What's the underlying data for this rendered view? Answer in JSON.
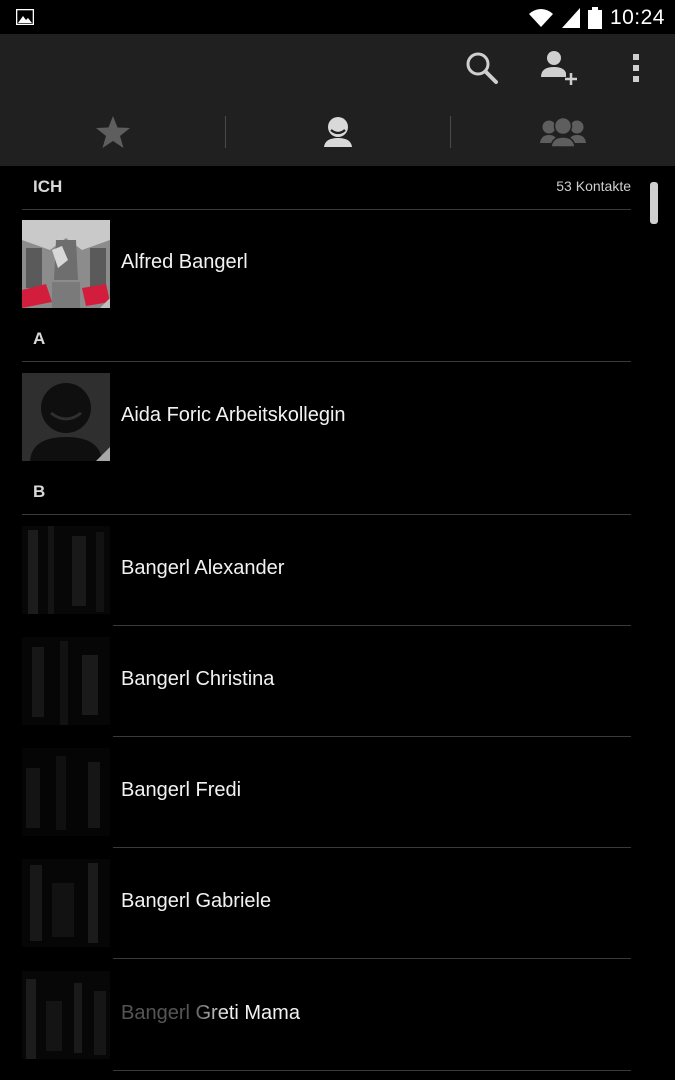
{
  "status_bar": {
    "time": "10:24",
    "left_icon": "gallery-notification-icon",
    "icons": [
      "wifi-icon",
      "signal-icon",
      "battery-icon"
    ]
  },
  "action_bar": {
    "actions": [
      {
        "icon": "search-icon",
        "label": "Search"
      },
      {
        "icon": "add-contact-icon",
        "label": "Add contact"
      },
      {
        "icon": "overflow-menu-icon",
        "label": "More options"
      }
    ]
  },
  "tabs": [
    {
      "icon": "star-icon",
      "selected": false
    },
    {
      "icon": "person-icon",
      "selected": true
    },
    {
      "icon": "group-icon",
      "selected": false
    }
  ],
  "list": {
    "me_header": {
      "label": "ICH",
      "count": "53 Kontakte"
    },
    "me": {
      "name": "Alfred Bangerl"
    },
    "sections": [
      {
        "letter": "A",
        "contacts": [
          {
            "name": "Aida Foric Arbeitskollegin",
            "avatar": "default-avatar"
          }
        ]
      },
      {
        "letter": "B",
        "contacts": [
          {
            "name": "Bangerl Alexander",
            "avatar": "photo"
          },
          {
            "name": "Bangerl Christina",
            "avatar": "photo"
          },
          {
            "name": "Bangerl Fredi",
            "avatar": "photo"
          },
          {
            "name": "Bangerl Gabriele",
            "avatar": "photo"
          },
          {
            "name": "Bangerl Greti Mama",
            "avatar": "photo"
          }
        ]
      }
    ]
  },
  "colors": {
    "background": "#000000",
    "bar": "#202020",
    "divider": "#3a3a3a",
    "text": "#f2f2f2",
    "icon_inactive": "#5e5e5e",
    "icon_active": "#d9d9d9"
  }
}
